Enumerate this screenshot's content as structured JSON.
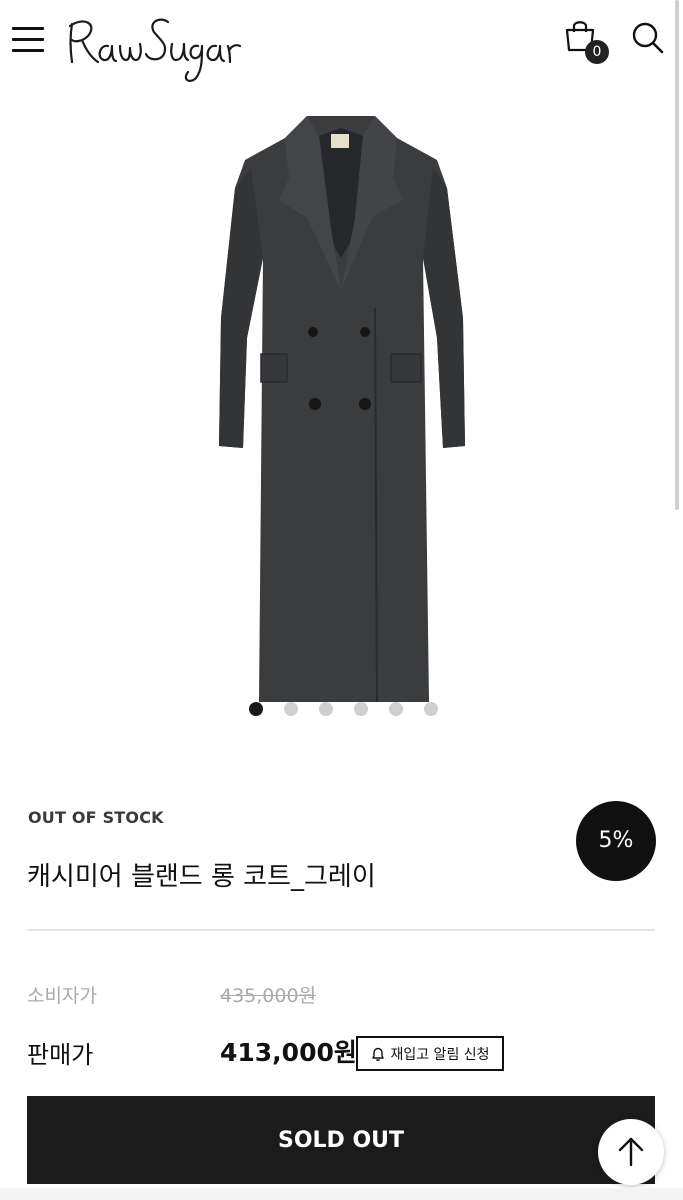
{
  "header": {
    "brand": "Raw Sugar",
    "cart_count": "0",
    "menu_icon": "hamburger-menu-icon",
    "cart_icon": "shopping-bag-icon",
    "search_icon": "search-icon"
  },
  "gallery": {
    "image": "charcoal gray double-breasted long wool coat",
    "slide_count": 6,
    "active_slide": 1
  },
  "product": {
    "stock_status": "OUT OF STOCK",
    "discount_badge": "5%",
    "name": "캐시미어 블랜드 롱 코트_그레이"
  },
  "pricing": {
    "retail_label": "소비자가",
    "retail_price": "435,000원",
    "sale_label": "판매가",
    "sale_price": "413,000원"
  },
  "actions": {
    "restock_alert": "재입고 알림 신청",
    "sold_out": "SOLD OUT",
    "scroll_top_icon": "arrow-up-icon"
  },
  "colors": {
    "primary": "#1b1b1b",
    "muted": "#aaaaaa",
    "dot_inactive": "#cfcfcf"
  }
}
